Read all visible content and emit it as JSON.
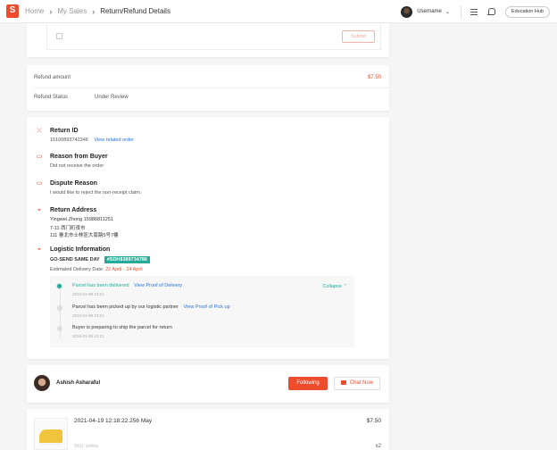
{
  "header": {
    "breadcrumbs": [
      "Home",
      "My Sales",
      "Return/Refund Details"
    ],
    "username": "Username",
    "education_hub": "Education Hub"
  },
  "top_card": {
    "submit_label": "Submit"
  },
  "refund": {
    "amount_label": "Refund amount",
    "amount_value": "$7.50",
    "status_label": "Refund Status",
    "status_value": "Under Review"
  },
  "details": {
    "return_id": {
      "title": "Return ID",
      "value": "15100893742346",
      "link": "View related order"
    },
    "reason": {
      "title": "Reason from Buyer",
      "value": "Did not receive the order"
    },
    "dispute": {
      "title": "Dispute Reason",
      "value": "I would like to reject the non-receipt claim."
    },
    "address": {
      "title": "Return Address",
      "lines": [
        "Yingwei.Zhong 15986811251",
        "7-11 西门町夜市",
        "111 臺北市士林區大南路5号7樓"
      ]
    },
    "logistics": {
      "title": "Logistic Information",
      "carrier": "GO-SEND SAME DAY",
      "tracking_number": "#SDH8389734786",
      "eta_label": "Estimated Delivery Date:",
      "eta_value": "22 April - 24 April",
      "collapse_label": "Collapse",
      "events": [
        {
          "title": "Parcel has been delivered",
          "link": "View Proof of Delivery",
          "time": "2019-01-08 13:21",
          "active": true
        },
        {
          "title": "Parcel has been picked up by our logistic partner",
          "link": "View Proof of Pick up",
          "time": "2019-01-08 13:21",
          "active": false
        },
        {
          "title": "Buyer is preparing to ship the parcel for return",
          "link": "",
          "time": "2019-01-08 13:21",
          "active": false
        }
      ]
    }
  },
  "shop": {
    "name": "Ashish Asharaful",
    "follow_label": "Following",
    "chat_label": "Chat Now"
  },
  "item": {
    "title": "2021-04-19 12:18:22.256 May",
    "price": "$7.50",
    "sku": "SKU: yellow",
    "qty": "x2"
  },
  "colors": {
    "brand": "#ee4d2d",
    "teal": "#26aa99",
    "link": "#2673dd"
  }
}
